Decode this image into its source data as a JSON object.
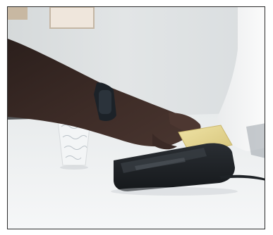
{
  "image": {
    "subject": "contactless-card-payment-photo",
    "colors": {
      "wall": "#dfe2e3",
      "counter": "#eef0f1",
      "skin": "#3a2a26",
      "watch": "#1c2228",
      "terminal": "#1f2327",
      "card": "#e3d48f",
      "shirt": "#f4f5f6"
    }
  }
}
